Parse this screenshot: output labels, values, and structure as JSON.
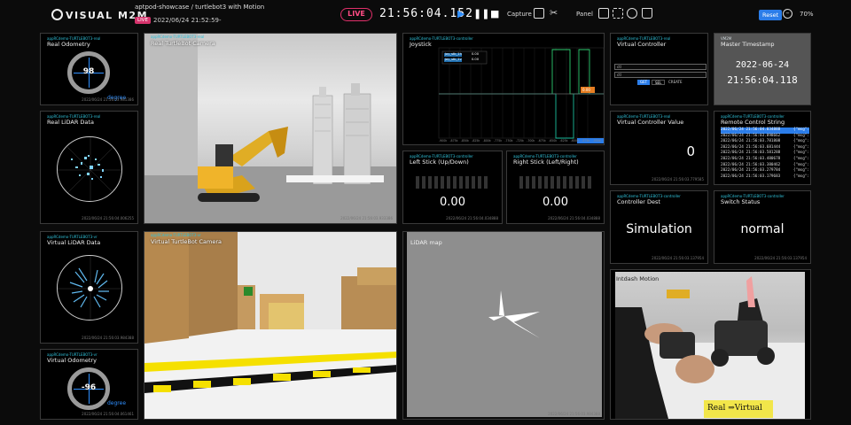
{
  "header": {
    "logo": "VISUAL M2M",
    "breadcrumb": "aptpod-showcase / turtlebot3 with Motion",
    "live_badge": "LIVE",
    "datetime": "2022/06/24 21:52:59-",
    "live_button": "LIVE",
    "clock": "21:56:04.152",
    "capture_label": "Capture",
    "panel_label": "Panel",
    "reset_label": "Reset",
    "zoom": "70%"
  },
  "panels": {
    "real_odometry": {
      "tag": "appRCdemo-TURTLEBOT3-real",
      "title": "Real Odometry",
      "value": "98",
      "unit": "degree",
      "foot": "2022/06/24 21:56:03.981386"
    },
    "real_lidar": {
      "tag": "appRCdemo-TURTLEBOT3-real",
      "title": "Real LiDAR Data",
      "foot": "2022/06/24 21:56:04.006255"
    },
    "virtual_lidar": {
      "tag": "appRCdemo-TURTLEBOT3-vr",
      "title": "Virtual LiDAR Data",
      "foot": "2022/06/24 21:56:03.984388"
    },
    "virtual_odometry": {
      "tag": "appRCdemo-TURTLEBOT3-vr",
      "title": "Virtual Odometry",
      "value": "-96",
      "unit": "degree",
      "foot": "2022/06/24 21:56:04.061461"
    },
    "real_camera": {
      "tag": "appRCdemo-TURTLEBOT3-real",
      "title": "Real TurtleBot Camera",
      "foot": "2022/06/24 21:56:03.933386"
    },
    "virtual_camera": {
      "tag": "appRCdemo-TURTLEBOT3-vr",
      "title": "Virtual TurtleBot Camera"
    },
    "joystick": {
      "tag": "appRCdemo-TURTLEBOT3-controller",
      "title": "Joystick",
      "legend": [
        "joy_stk_1h",
        "joy_stk_1v"
      ],
      "legend_vals": [
        "0.00",
        "0.00"
      ],
      "marker": "0.00",
      "xticks": [
        "-900k",
        "-875k",
        "-850k",
        "-825k",
        "-800k",
        "-775k",
        "-750k",
        "-725k",
        "-700k",
        "-675k",
        "-650k",
        "-625k",
        "-600k",
        "-575k",
        "-550k"
      ]
    },
    "left_stick": {
      "tag": "appRCdemo-TURTLEBOT3-controller",
      "title": "Left Stick (Up/Down)",
      "value": "0.00",
      "foot": "2022/06/24 21:56:04.034888"
    },
    "right_stick": {
      "tag": "appRCdemo-TURTLEBOT3-controller",
      "title": "Right Stick (Left/Right)",
      "value": "0.00",
      "foot": "2022/06/24 21:56:04.034888"
    },
    "lidar_map": {
      "tag": "appRCdemo-TURTLEBOT3-vr",
      "title": "LiDAR map",
      "foot": "2022/06/24 21:56:03.984388"
    },
    "virtual_controller": {
      "tag": "appRCdemo-TURTLEBOT3-real",
      "title": "Virtual Controller",
      "select1": "ctl",
      "select2": "ctl",
      "btn1": "GET",
      "btn2": "SEL",
      "btn3": "CREATE"
    },
    "master_timestamp": {
      "tag": "VM2M",
      "title": "Master Timestamp",
      "date": "2022-06-24",
      "time": "21:56:04.118"
    },
    "virtual_controller_value": {
      "tag": "appRCdemo-TURTLEBOT3-real",
      "title": "Virtual Controller Value",
      "value": "0",
      "foot": "2022/06/24 21:56:03.779585"
    },
    "remote_control_string": {
      "tag": "appRCdemo-TURTLEBOT3-controller",
      "title": "Remote Control String",
      "items": [
        {
          "ts": "2022/06/24 21:56:04.034888",
          "msg": "{\"msg\":"
        },
        {
          "ts": "2022/06/24 21:56:03.898662",
          "msg": "{\"msg\":"
        },
        {
          "ts": "2022/06/24 21:56:03.781808",
          "msg": "{\"msg\":"
        },
        {
          "ts": "2022/06/24 21:56:03.681444",
          "msg": "{\"msg\":"
        },
        {
          "ts": "2022/06/24 21:56:03.581288",
          "msg": "{\"msg\":"
        },
        {
          "ts": "2022/06/24 21:56:03.480678",
          "msg": "{\"msg\":"
        },
        {
          "ts": "2022/06/24 21:56:03.380462",
          "msg": "{\"msg\":"
        },
        {
          "ts": "2022/06/24 21:56:03.279784",
          "msg": "{\"msg\":"
        },
        {
          "ts": "2022/06/24 21:56:03.179683",
          "msg": "{\"msg\":"
        }
      ]
    },
    "controller_dest": {
      "tag": "appRCdemo-TURTLEBOT3-controller",
      "title": "Controller Dest",
      "value": "Simulation",
      "foot": "2022/06/24 21:56:03.137954"
    },
    "switch_status": {
      "tag": "appRCdemo-TURTLEBOT3-controller",
      "title": "Switch Status",
      "value": "normal",
      "foot": "2022/06/24 21:56:03.137954"
    },
    "motion": {
      "title": "Intdash Motion",
      "sign": "Real ⇒Virtual"
    }
  },
  "colors": {
    "accent": "#2b7de9",
    "live": "#e0306a",
    "tag": "#2fc0d8"
  }
}
